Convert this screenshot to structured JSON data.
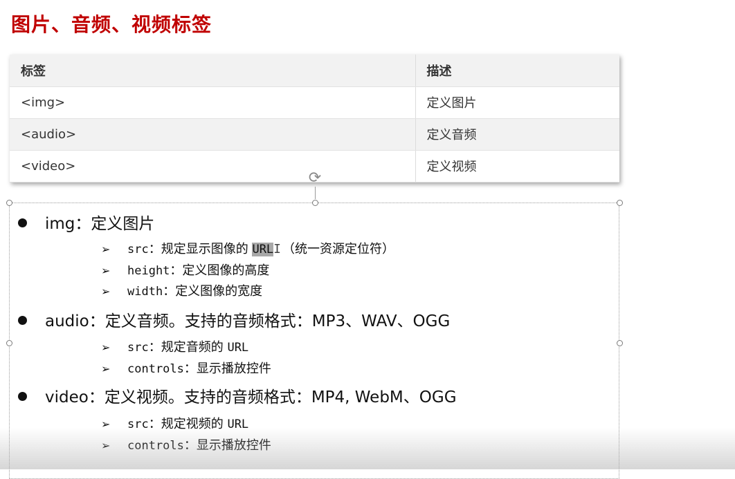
{
  "slide": {
    "title": "图片、音频、视频标签"
  },
  "table": {
    "headers": [
      "标签",
      "描述"
    ],
    "rows": [
      [
        "<img>",
        "定义图片"
      ],
      [
        "<audio>",
        "定义音频"
      ],
      [
        "<video>",
        "定义视频"
      ]
    ]
  },
  "bullets": [
    {
      "label": "img：定义图片",
      "subs": [
        {
          "code": "src",
          "sep": "：",
          "text_a": "规定显示图像的 ",
          "highlight": "URL",
          "text_b": "（统一资源定位符）"
        },
        {
          "code": "height",
          "sep": "：",
          "text_a": "定义图像的高度"
        },
        {
          "code": "width",
          "sep": "：",
          "text_a": "定义图像的宽度"
        }
      ]
    },
    {
      "label": "audio：定义音频。支持的音频格式：MP3、WAV、OGG",
      "subs": [
        {
          "code": "src",
          "sep": "：",
          "text_a": "规定音频的 ",
          "code2": "URL"
        },
        {
          "code": "controls",
          "sep": "：",
          "text_a": "显示播放控件"
        }
      ]
    },
    {
      "label": "video：定义视频。支持的音频格式：MP4, WebM、OGG",
      "subs": [
        {
          "code": "src",
          "sep": "：",
          "text_a": "规定视频的 ",
          "code2": "URL"
        },
        {
          "code": "controls",
          "sep": "：",
          "text_a": "显示播放控件"
        }
      ]
    }
  ],
  "glyphs": {
    "arrow": "➢",
    "rotate": "⟳",
    "ibeam": "I"
  },
  "colors": {
    "title": "#c00000",
    "highlight": "#a8a8a8"
  }
}
